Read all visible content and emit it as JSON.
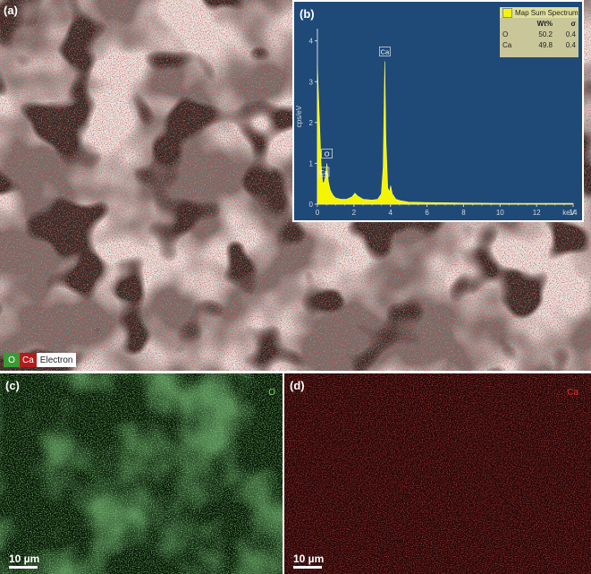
{
  "panels": {
    "a": {
      "label": "(a)",
      "legend": {
        "o": "O",
        "ca": "Ca",
        "electron": "Electron"
      }
    },
    "b": {
      "label": "(b)"
    },
    "c": {
      "label": "(c)",
      "element": "O",
      "scale": "10 µm"
    },
    "d": {
      "label": "(d)",
      "element": "Ca",
      "scale": "10 µm"
    }
  },
  "spectrum": {
    "legend_title": "Map Sum Spectrum",
    "columns": [
      "Wt%",
      "σ"
    ],
    "rows": [
      {
        "element": "O",
        "wt": "50.2",
        "sigma": "0.4"
      },
      {
        "element": "Ca",
        "wt": "49.8",
        "sigma": "0.4"
      }
    ],
    "ylabel": "cps/eV",
    "xunit": "keV",
    "peak_labels": [
      "Ca",
      "O",
      "Ca"
    ]
  },
  "chart_data": {
    "type": "area",
    "xlabel": "keV",
    "ylabel": "cps/eV",
    "xlim": [
      0,
      14
    ],
    "ylim": [
      0,
      4.3
    ],
    "xticks": [
      0,
      2,
      4,
      6,
      8,
      10,
      12,
      14
    ],
    "yticks": [
      0,
      1,
      2,
      3,
      4
    ],
    "series": [
      {
        "name": "Map Sum Spectrum",
        "x": [
          0.0,
          0.1,
          0.2,
          0.28,
          0.35,
          0.45,
          0.52,
          0.6,
          0.7,
          0.85,
          1.0,
          1.3,
          1.6,
          1.9,
          2.05,
          2.2,
          2.5,
          3.0,
          3.3,
          3.5,
          3.6,
          3.69,
          3.75,
          3.85,
          3.95,
          4.01,
          4.1,
          4.3,
          4.6,
          5.0,
          6.0,
          8.0,
          10.0,
          12.0,
          14.0
        ],
        "y": [
          3.4,
          2.2,
          1.0,
          0.55,
          0.5,
          0.7,
          1.0,
          0.55,
          0.35,
          0.22,
          0.15,
          0.12,
          0.12,
          0.18,
          0.27,
          0.2,
          0.12,
          0.1,
          0.12,
          0.25,
          0.9,
          3.5,
          1.6,
          0.4,
          0.3,
          0.45,
          0.25,
          0.12,
          0.08,
          0.05,
          0.04,
          0.03,
          0.02,
          0.02,
          0.02
        ]
      }
    ],
    "colors": {
      "fill": "#f5f500",
      "background": "#1f4a78"
    }
  }
}
